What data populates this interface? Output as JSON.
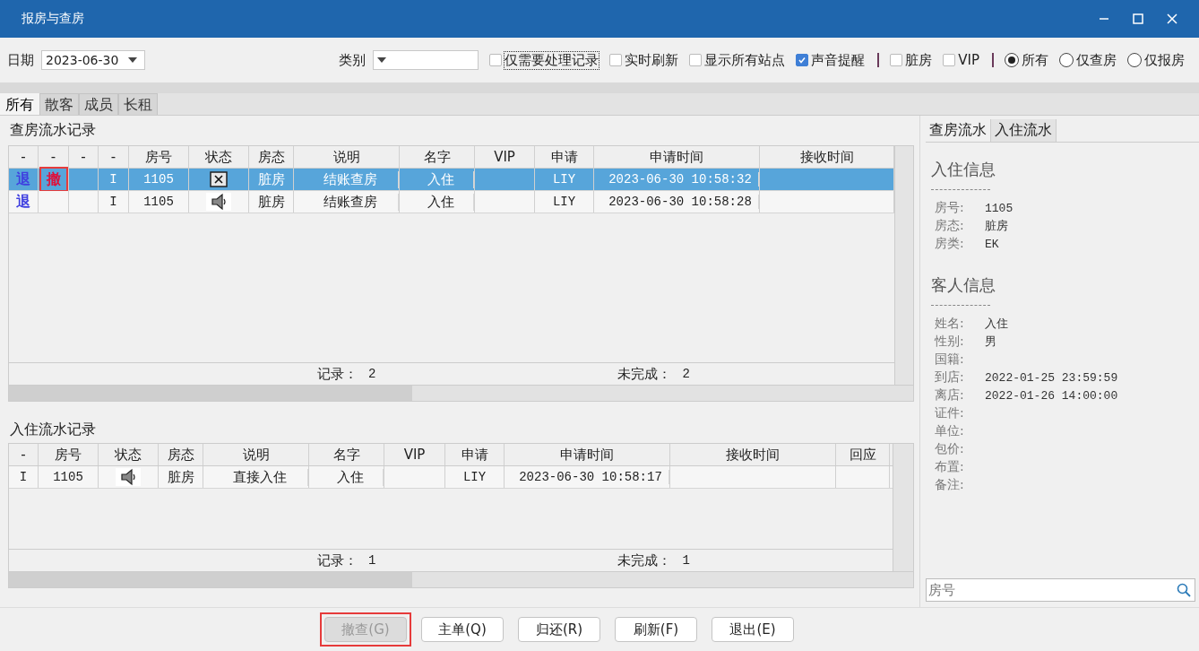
{
  "window": {
    "title": "报房与查房"
  },
  "toolbar": {
    "date_label": "日期",
    "date_value": "2023-06-30",
    "category_label": "类别",
    "options": [
      {
        "kind": "checkbox",
        "label": "仅需要处理记录",
        "checked": false,
        "focused": true
      },
      {
        "kind": "checkbox",
        "label": "实时刷新",
        "checked": false,
        "focused": false
      },
      {
        "kind": "checkbox",
        "label": "显示所有站点",
        "checked": false,
        "focused": false
      },
      {
        "kind": "checkbox",
        "label": "声音提醒",
        "checked": true,
        "focused": false
      },
      {
        "kind": "separator"
      },
      {
        "kind": "checkbox",
        "label": "脏房",
        "checked": false,
        "focused": false
      },
      {
        "kind": "checkbox",
        "label": "VIP",
        "checked": false,
        "focused": false
      },
      {
        "kind": "separator"
      },
      {
        "kind": "radio",
        "label": "所有",
        "selected": true
      },
      {
        "kind": "radio",
        "label": "仅查房",
        "selected": false
      },
      {
        "kind": "radio",
        "label": "仅报房",
        "selected": false
      }
    ]
  },
  "tabs": [
    {
      "label": "所有",
      "selected": true
    },
    {
      "label": "散客",
      "selected": false
    },
    {
      "label": "成员",
      "selected": false
    },
    {
      "label": "长租",
      "selected": false
    }
  ],
  "check_log": {
    "title": "查房流水记录",
    "columns": [
      "-",
      "-",
      "-",
      "-",
      "房号",
      "状态",
      "房态",
      "说明",
      "名字",
      "VIP",
      "申请",
      "申请时间",
      "接收时间"
    ],
    "rows": [
      {
        "selected": true,
        "return": "退",
        "revoke": "撤",
        "revoke_highlighted": true,
        "flag": "I",
        "room": "1105",
        "kind": "cross",
        "room_state": "脏房",
        "note": "结账查房",
        "name": "入住",
        "applicant": "LIY",
        "apply_time": "2023-06-30 10:58:32"
      },
      {
        "selected": false,
        "return": "退",
        "revoke_highlighted": false,
        "flag": "I",
        "room": "1105",
        "kind": "speaker",
        "room_state": "脏房",
        "note": "结账查房",
        "name": "入住",
        "applicant": "LIY",
        "apply_time": "2023-06-30 10:58:28"
      }
    ],
    "footer": {
      "count_label": "记录：",
      "count": "2",
      "pending_label": "未完成：",
      "pending": "2"
    }
  },
  "checkin_log": {
    "title": "入住流水记录",
    "columns": [
      "-",
      "房号",
      "状态",
      "房态",
      "说明",
      "名字",
      "VIP",
      "申请",
      "申请时间",
      "接收时间",
      "回应"
    ],
    "rows": [
      {
        "selected": false,
        "flag": "I",
        "room": "1105",
        "kind": "speaker",
        "room_state": "脏房",
        "note": "直接入住",
        "name": "入住",
        "applicant": "LIY",
        "apply_time": "2023-06-30 10:58:17"
      }
    ],
    "footer": {
      "count_label": "记录：",
      "count": "1",
      "pending_label": "未完成：",
      "pending": "1"
    }
  },
  "side_panel": {
    "tabs": [
      {
        "label": "查房流水",
        "selected": true
      },
      {
        "label": "入住流水",
        "selected": false
      }
    ],
    "sections": [
      {
        "title": "入住信息",
        "fields": [
          {
            "label": "房号:",
            "value": "1105"
          },
          {
            "label": "房态:",
            "value": "脏房"
          },
          {
            "label": "房类:",
            "value": "EK"
          }
        ]
      },
      {
        "title": "客人信息",
        "fields": [
          {
            "label": "姓名:",
            "value": "入住"
          },
          {
            "label": "性别:",
            "value": "男"
          },
          {
            "label": "国籍:"
          },
          {
            "label": "到店:",
            "value": "2022-01-25 23:59:59"
          },
          {
            "label": "离店:",
            "value": "2022-01-26 14:00:00"
          },
          {
            "label": "证件:"
          },
          {
            "label": "单位:"
          },
          {
            "label": "包价:"
          },
          {
            "label": "布置:"
          },
          {
            "label": "备注:"
          }
        ]
      }
    ],
    "search": {
      "placeholder": "房号"
    }
  },
  "buttons": [
    {
      "label": "撤查(G)",
      "disabled": true,
      "highlighted": true
    },
    {
      "label": "主单(Q)",
      "disabled": false,
      "highlighted": false
    },
    {
      "label": "归还(R)",
      "disabled": false,
      "highlighted": false
    },
    {
      "label": "刷新(F)",
      "disabled": false,
      "highlighted": false
    },
    {
      "label": "退出(E)",
      "disabled": false,
      "highlighted": false
    }
  ]
}
